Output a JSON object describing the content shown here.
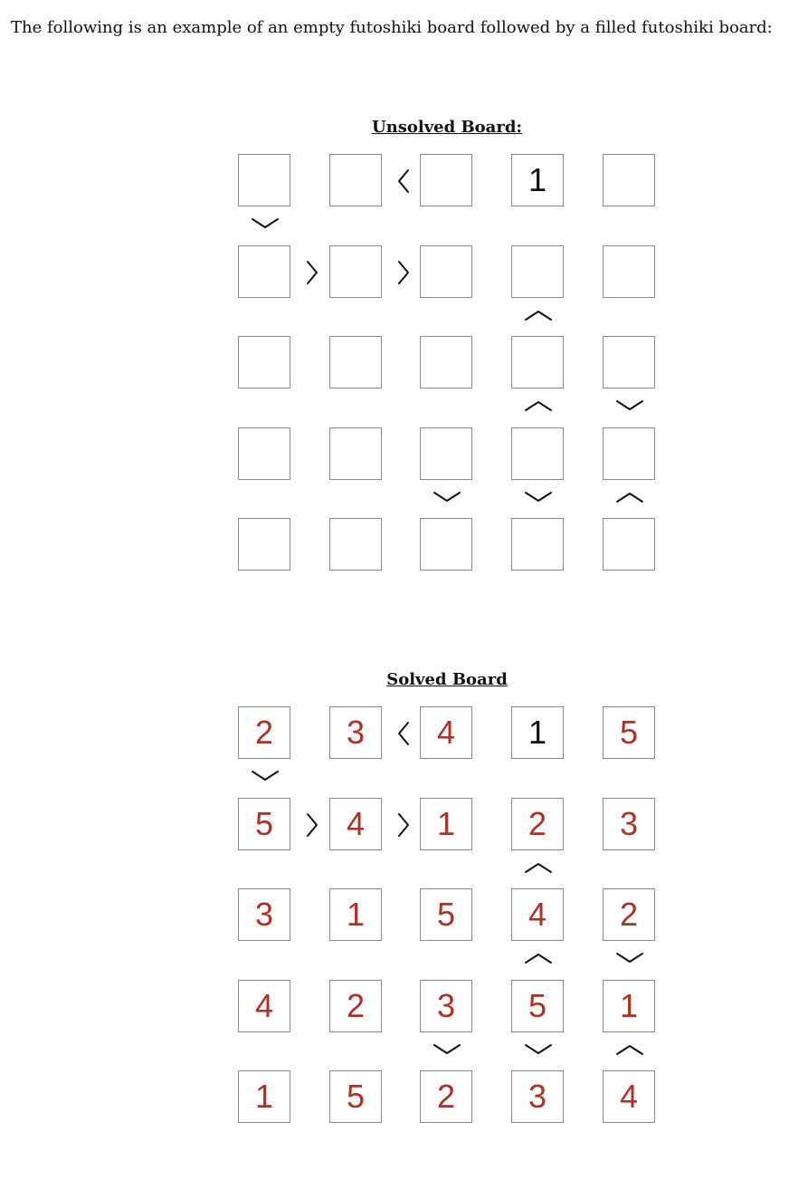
{
  "intro_text": "The following is an example of an empty futoshiki board followed by a filled futoshiki board:",
  "unsolved": {
    "title": "Unsolved Board:",
    "cells": [
      [
        "",
        "",
        "",
        "1",
        ""
      ],
      [
        "",
        "",
        "",
        "",
        ""
      ],
      [
        "",
        "",
        "",
        "",
        ""
      ],
      [
        "",
        "",
        "",
        "",
        ""
      ],
      [
        "",
        "",
        "",
        "",
        ""
      ]
    ]
  },
  "solved": {
    "title": "Solved Board",
    "cells": [
      [
        "2",
        "3",
        "4",
        "1",
        "5"
      ],
      [
        "5",
        "4",
        "1",
        "2",
        "3"
      ],
      [
        "3",
        "1",
        "5",
        "4",
        "2"
      ],
      [
        "4",
        "2",
        "3",
        "5",
        "1"
      ],
      [
        "1",
        "5",
        "2",
        "3",
        "4"
      ]
    ]
  },
  "given_cells": [
    [
      0,
      3
    ]
  ],
  "horizontal_constraints": [
    {
      "row": 0,
      "col": 1,
      "sign": "<"
    },
    {
      "row": 1,
      "col": 0,
      "sign": ">"
    },
    {
      "row": 1,
      "col": 1,
      "sign": ">"
    }
  ],
  "vertical_constraints": [
    {
      "row": 0,
      "col": 0,
      "sign": "v"
    },
    {
      "row": 1,
      "col": 3,
      "sign": "^"
    },
    {
      "row": 2,
      "col": 3,
      "sign": "^"
    },
    {
      "row": 2,
      "col": 4,
      "sign": "v"
    },
    {
      "row": 3,
      "col": 2,
      "sign": "v"
    },
    {
      "row": 3,
      "col": 3,
      "sign": "v"
    },
    {
      "row": 3,
      "col": 4,
      "sign": "^"
    }
  ],
  "colors": {
    "given_digit": "#111111",
    "filled_digit": "#b03025",
    "cell_border": "#8a8a8a"
  }
}
